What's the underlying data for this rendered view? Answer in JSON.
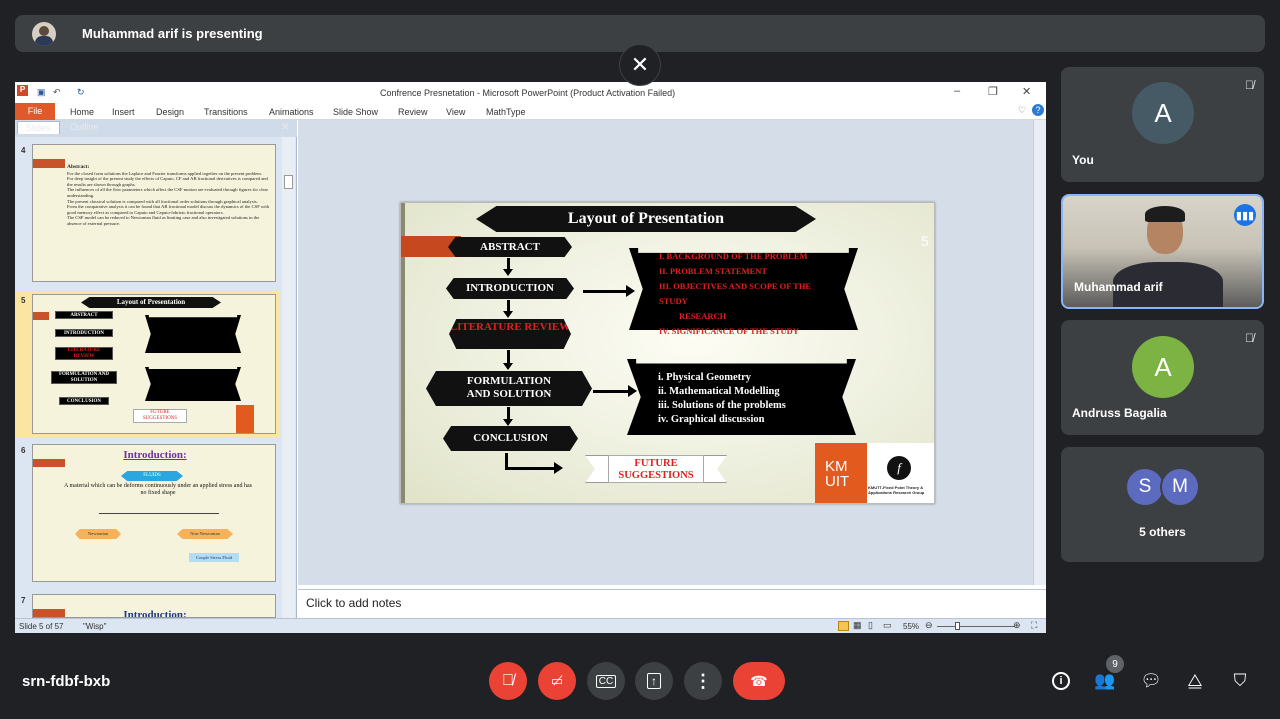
{
  "banner": {
    "presenting_text": "Muhammad arif is presenting"
  },
  "powerpoint": {
    "window_title": "Confrence Presnetation  -  Microsoft PowerPoint (Product Activation Failed)",
    "menu": [
      "File",
      "Home",
      "Insert",
      "Design",
      "Transitions",
      "Animations",
      "Slide Show",
      "Review",
      "View",
      "MathType"
    ],
    "left_tabs": {
      "slides": "Slides",
      "outline": "Outline"
    },
    "thumb_numbers": [
      "4",
      "5",
      "6",
      "7"
    ],
    "thumb4": {
      "heading": "Abstract:",
      "bullets": [
        "For the closed form solutions the Laplace and Fourier transforms applied together on the present problem.",
        "For deep insight of the present study the effects of Caputo, CF and AB fractional derivatives is compared and the results are shown through graphs.",
        "The influences of all the flow parameters which affect the CSF motion are evaluated through figures for clear understanding.",
        "The present classical solution is compared with all fractional order solutions through graphical analysis.",
        "From the comparative analysis it can be found that AB fractional model discuss the dynamics of the CSF with good memory effect as compared to Caputo and Caputo-fabrizio fractional operators.",
        "The CSF model can be reduced to Newtonian fluid as limiting case and also investigated solutions in the absence of external pressure."
      ]
    },
    "thumb5_title": "Layout of Presentation",
    "thumb6": {
      "title": "Introduction:",
      "fluids": "FLUIDS",
      "definition": "A material which can be deforms continuously under an applied stress and has no fixed shape",
      "newtonian": "Newtonian",
      "non_newtonian": "Non-Newtonian",
      "couple_stress": "Couple Stress Fluid"
    },
    "thumb7_title": "Introduction:",
    "notes_placeholder": "Click to add notes",
    "status": {
      "slide": "Slide 5 of 57",
      "theme": "\"Wisp\"",
      "zoom": "55%"
    }
  },
  "slide": {
    "title": "Layout of Presentation",
    "page_number": "5",
    "steps": [
      "ABSTRACT",
      "INTRODUCTION",
      "LITERATURE REVIEW",
      "FORMULATION AND SOLUTION",
      "CONCLUSION"
    ],
    "future": "FUTURE SUGGESTIONS",
    "intro_items": [
      "I.   BACKGROUND OF THE PROBLEM",
      "II.   PROBLEM STATEMENT",
      "III.   OBJECTIVES AND SCOPE OF THE STUDY",
      "IV.   SIGNIFICANCE OF THE STUDY"
    ],
    "intro_items_wrap": "RESEARCH",
    "formulation_items": [
      "i.    Physical Geometry",
      "ii.   Mathematical  Modelling",
      "iii.  Solutions of the problems",
      "iv.   Graphical  discussion"
    ],
    "logo1": "KM\nUIT",
    "logo2_text": "KMUTT-Fixed Point Theory & Applications Research Group"
  },
  "participants": [
    {
      "name": "You",
      "initial": "A",
      "color": "#455a64"
    },
    {
      "name": "Muhammad arif"
    },
    {
      "name": "Andruss Bagalia",
      "initial": "A",
      "color": "#7cb342"
    },
    {
      "name": "5 others",
      "initials": [
        "S",
        "M"
      ],
      "color": "#5c6bc0"
    }
  ],
  "meeting": {
    "code": "srn-fdbf-bxb",
    "people_count": "9"
  }
}
